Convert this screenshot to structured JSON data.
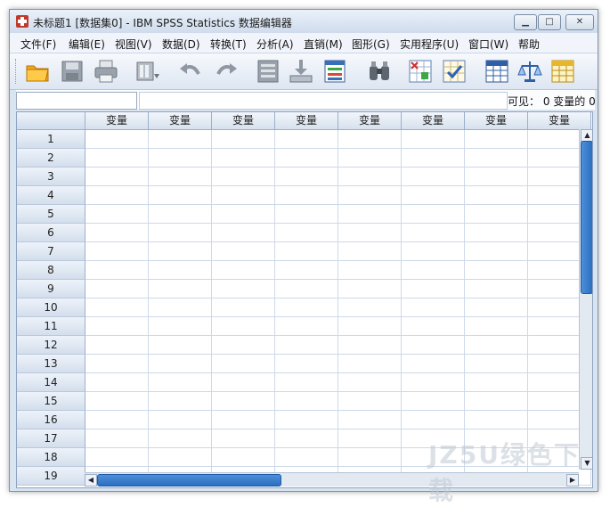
{
  "window": {
    "title": "未标题1 [数据集0] - IBM SPSS Statistics 数据编辑器",
    "controls": {
      "minimize": "▁",
      "maximize": "□",
      "close": "✕"
    }
  },
  "menu": [
    "文件(F)",
    "编辑(E)",
    "视图(V)",
    "数据(D)",
    "转换(T)",
    "分析(A)",
    "直销(M)",
    "图形(G)",
    "实用程序(U)",
    "窗口(W)",
    "帮助"
  ],
  "toolbar": {
    "icons": [
      "open-folder-icon",
      "save-icon",
      "print-icon",
      "dialog-recall-icon",
      "undo-icon",
      "redo-icon",
      "go-to-case-icon",
      "go-to-variable-icon",
      "variables-icon",
      "find-icon",
      "insert-cases-icon",
      "insert-variable-icon",
      "split-file-icon",
      "weight-cases-icon",
      "select-cases-icon"
    ]
  },
  "cell_editor": {
    "name_value": "",
    "content_value": "",
    "visible_text": "可见： 0 变量的 0"
  },
  "grid": {
    "column_header": "变量",
    "columns": [
      "变量",
      "变量",
      "变量",
      "变量",
      "变量",
      "变量",
      "变量",
      "变量"
    ],
    "rows": [
      "1",
      "2",
      "3",
      "4",
      "5",
      "6",
      "7",
      "8",
      "9",
      "10",
      "11",
      "12",
      "13",
      "14",
      "15",
      "16",
      "17",
      "18",
      "19"
    ]
  },
  "watermark": "JZ5U绿色下载",
  "colors": {
    "scroll_thumb": "#2a6fc0",
    "header_bg": "#d6e1ee",
    "grid_line": "#cdd9e8"
  }
}
